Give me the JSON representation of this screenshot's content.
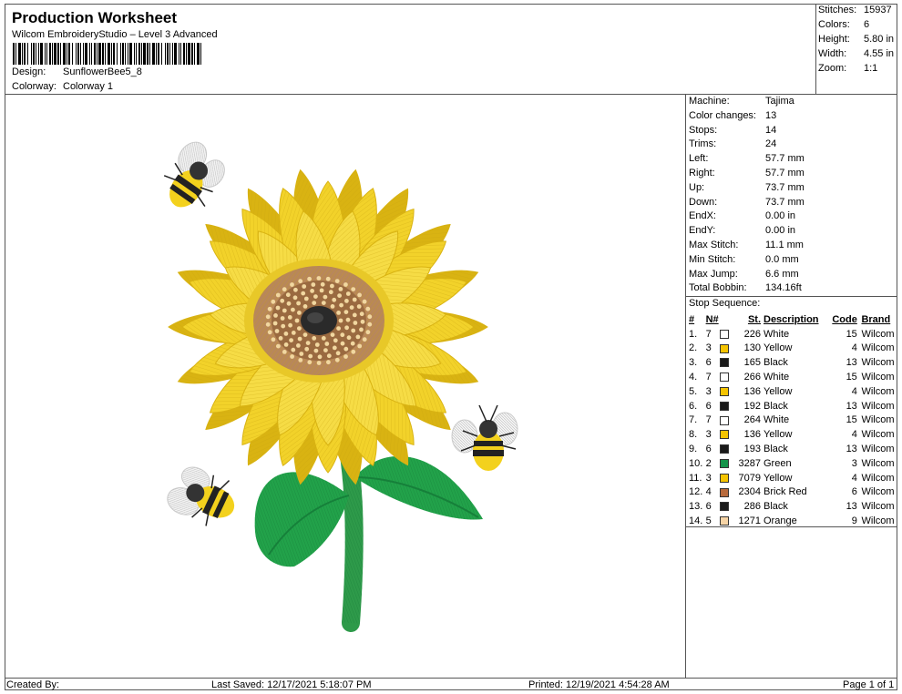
{
  "header": {
    "title": "Production Worksheet",
    "subtitle": "Wilcom EmbroideryStudio – Level 3 Advanced",
    "design_label": "Design:",
    "design_value": "SunflowerBee5_8",
    "colorway_label": "Colorway:",
    "colorway_value": "Colorway 1"
  },
  "summary": [
    {
      "label": "Stitches:",
      "value": "15937"
    },
    {
      "label": "Colors:",
      "value": "6"
    },
    {
      "label": "Height:",
      "value": "5.80 in"
    },
    {
      "label": "Width:",
      "value": "4.55 in"
    },
    {
      "label": "Zoom:",
      "value": "1:1"
    }
  ],
  "machine_info": [
    {
      "label": "Machine:",
      "value": "Tajima"
    },
    {
      "label": "Color changes:",
      "value": "13"
    },
    {
      "label": "Stops:",
      "value": "14"
    },
    {
      "label": "Trims:",
      "value": "24"
    },
    {
      "label": "Left:",
      "value": "57.7 mm"
    },
    {
      "label": "Right:",
      "value": "57.7 mm"
    },
    {
      "label": "Up:",
      "value": "73.7 mm"
    },
    {
      "label": "Down:",
      "value": "73.7 mm"
    },
    {
      "label": "EndX:",
      "value": "0.00 in"
    },
    {
      "label": "EndY:",
      "value": "0.00 in"
    },
    {
      "label": "Max Stitch:",
      "value": "11.1 mm"
    },
    {
      "label": "Min Stitch:",
      "value": "0.0 mm"
    },
    {
      "label": "Max Jump:",
      "value": "6.6 mm"
    },
    {
      "label": "Total Bobbin:",
      "value": "134.16ft"
    }
  ],
  "stop_sequence": {
    "title": "Stop Sequence:",
    "columns": [
      "#",
      "N#",
      "St.",
      "Description",
      "Code",
      "Brand"
    ],
    "rows": [
      {
        "num": "1.",
        "n": "7",
        "color": "#ffffff",
        "st": "226",
        "desc": "White",
        "code": "15",
        "brand": "Wilcom"
      },
      {
        "num": "2.",
        "n": "3",
        "color": "#f5c400",
        "st": "130",
        "desc": "Yellow",
        "code": "4",
        "brand": "Wilcom"
      },
      {
        "num": "3.",
        "n": "6",
        "color": "#1a1a1a",
        "st": "165",
        "desc": "Black",
        "code": "13",
        "brand": "Wilcom"
      },
      {
        "num": "4.",
        "n": "7",
        "color": "#ffffff",
        "st": "266",
        "desc": "White",
        "code": "15",
        "brand": "Wilcom"
      },
      {
        "num": "5.",
        "n": "3",
        "color": "#f5c400",
        "st": "136",
        "desc": "Yellow",
        "code": "4",
        "brand": "Wilcom"
      },
      {
        "num": "6.",
        "n": "6",
        "color": "#1a1a1a",
        "st": "192",
        "desc": "Black",
        "code": "13",
        "brand": "Wilcom"
      },
      {
        "num": "7.",
        "n": "7",
        "color": "#ffffff",
        "st": "264",
        "desc": "White",
        "code": "15",
        "brand": "Wilcom"
      },
      {
        "num": "8.",
        "n": "3",
        "color": "#f5c400",
        "st": "136",
        "desc": "Yellow",
        "code": "4",
        "brand": "Wilcom"
      },
      {
        "num": "9.",
        "n": "6",
        "color": "#1a1a1a",
        "st": "193",
        "desc": "Black",
        "code": "13",
        "brand": "Wilcom"
      },
      {
        "num": "10.",
        "n": "2",
        "color": "#14944a",
        "st": "3287",
        "desc": "Green",
        "code": "3",
        "brand": "Wilcom"
      },
      {
        "num": "11.",
        "n": "3",
        "color": "#f5c400",
        "st": "7079",
        "desc": "Yellow",
        "code": "4",
        "brand": "Wilcom"
      },
      {
        "num": "12.",
        "n": "4",
        "color": "#b86a3c",
        "st": "2304",
        "desc": "Brick Red",
        "code": "6",
        "brand": "Wilcom"
      },
      {
        "num": "13.",
        "n": "6",
        "color": "#1a1a1a",
        "st": "286",
        "desc": "Black",
        "code": "13",
        "brand": "Wilcom"
      },
      {
        "num": "14.",
        "n": "5",
        "color": "#f6d4a6",
        "st": "1271",
        "desc": "Orange",
        "code": "9",
        "brand": "Wilcom"
      }
    ]
  },
  "footer": {
    "created_by": "Created By:",
    "last_saved": "Last Saved: 12/17/2021 5:18:07 PM",
    "printed": "Printed: 12/19/2021 4:54:28 AM",
    "page": "Page 1 of 1"
  },
  "colors": {
    "petal": "#f2d22a",
    "petal_dark": "#d9b312",
    "center_ring": "#b8875a",
    "center_dot": "#f1d7a0",
    "center_core": "#2a2a2a",
    "leaf": "#22a24a",
    "stem": "#2e9a4a",
    "bee_yellow": "#f3d11d",
    "bee_black": "#222222",
    "wing": "#f4f4f4"
  },
  "artwork": {
    "name": "sunflower-with-bees"
  }
}
